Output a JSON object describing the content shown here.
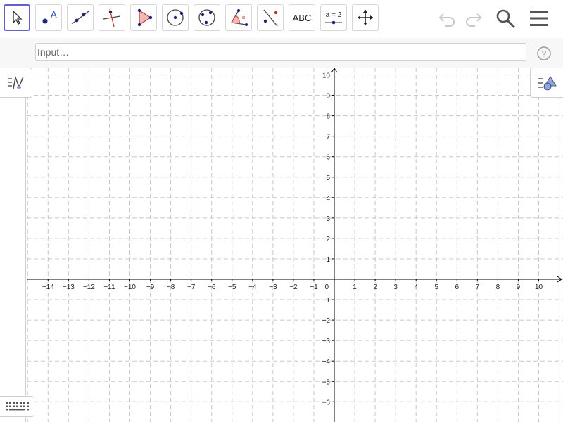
{
  "toolbar": {
    "tools": [
      {
        "name": "move-tool",
        "icon": "cursor-arrow-icon",
        "active": true
      },
      {
        "name": "point-tool",
        "icon": "point-icon"
      },
      {
        "name": "line-tool",
        "icon": "line-icon"
      },
      {
        "name": "perpendicular-line-tool",
        "icon": "perpendicular-line-icon"
      },
      {
        "name": "polygon-tool",
        "icon": "polygon-icon"
      },
      {
        "name": "circle-tool",
        "icon": "circle-center-point-icon"
      },
      {
        "name": "circle-three-points-tool",
        "icon": "circle-three-points-icon"
      },
      {
        "name": "angle-tool",
        "icon": "angle-icon"
      },
      {
        "name": "reflect-tool",
        "icon": "reflect-about-line-icon"
      },
      {
        "name": "text-tool",
        "icon": "text-icon",
        "label": "ABC"
      },
      {
        "name": "slider-tool",
        "icon": "slider-icon",
        "label": "a = 2"
      },
      {
        "name": "move-graphics-view-tool",
        "icon": "move-arrows-icon"
      }
    ],
    "undo_icon": "undo-icon",
    "redo_icon": "redo-icon",
    "search_icon": "search-icon",
    "menu_icon": "hamburger-menu-icon"
  },
  "input_bar": {
    "placeholder": "Input…",
    "help_icon": "help-icon"
  },
  "graphics_view": {
    "x_ticks": [
      "−14",
      "−13",
      "−12",
      "−11",
      "−10",
      "−9",
      "−8",
      "−7",
      "−6",
      "−5",
      "−4",
      "−3",
      "−2",
      "−1",
      "1",
      "2",
      "3",
      "4",
      "5",
      "6",
      "7",
      "8",
      "9",
      "10"
    ],
    "y_ticks_positive": [
      "1",
      "2",
      "3",
      "4",
      "5",
      "6",
      "7",
      "8",
      "9",
      "10"
    ],
    "y_ticks_negative": [
      "−1",
      "−2",
      "−3",
      "−4",
      "−5",
      "−6"
    ],
    "origin_label": "0",
    "grid": true,
    "colors": {
      "grid": "#c8c8c8",
      "axis": "#000000",
      "accent": "#6060d0"
    }
  },
  "side_buttons": {
    "algebra_icon": "algebra-view-icon",
    "style_icon": "style-bar-icon",
    "keyboard_icon": "keyboard-icon"
  }
}
